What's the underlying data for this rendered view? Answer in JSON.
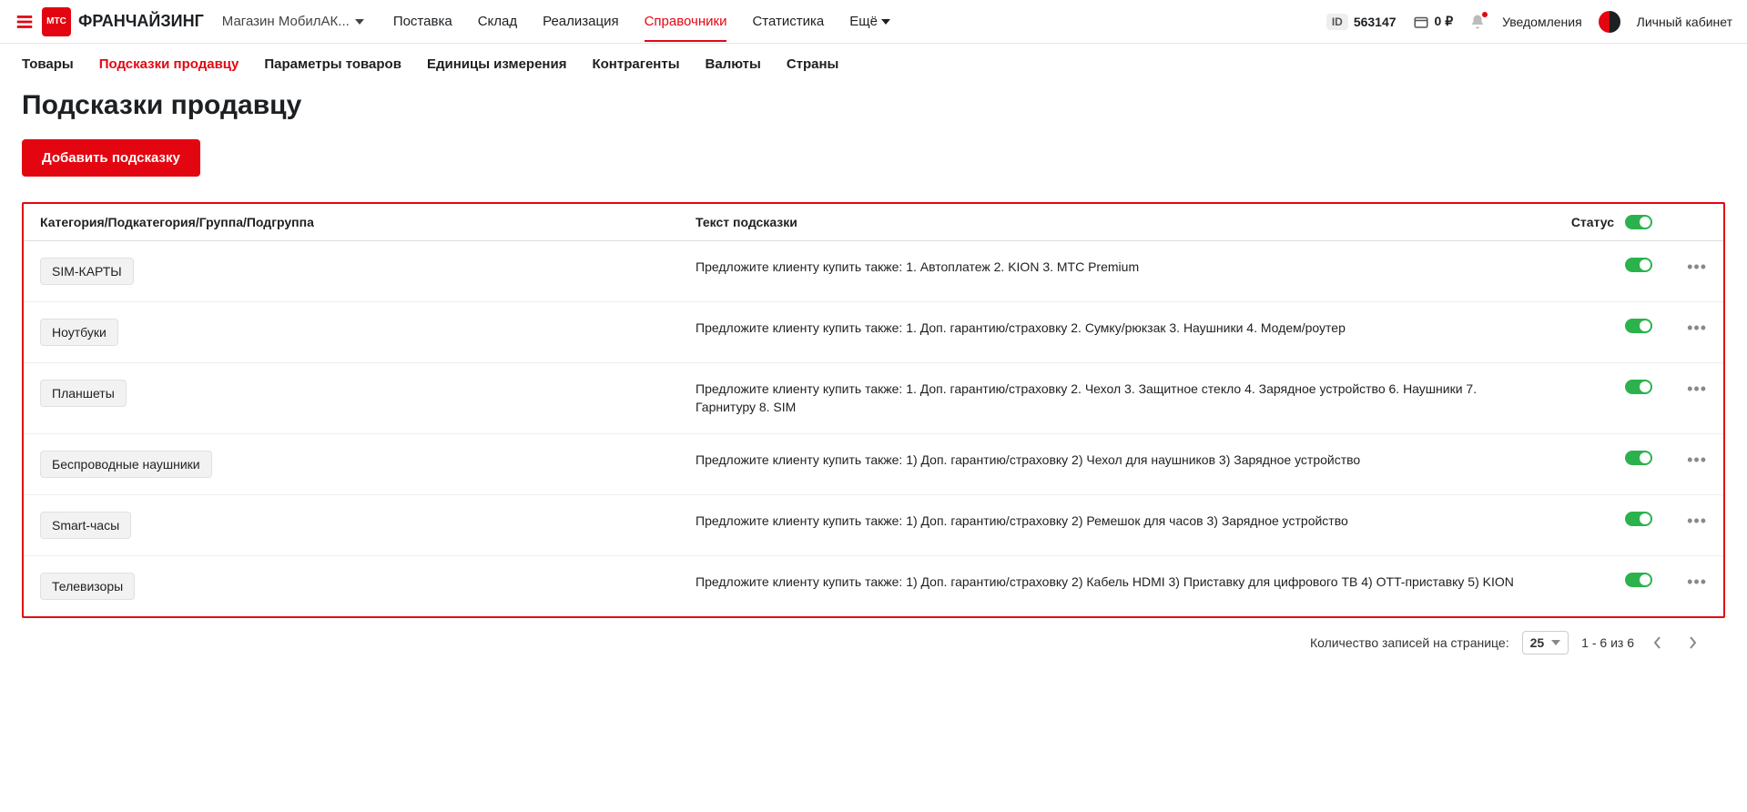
{
  "header": {
    "brand": "ФРАНЧАЙЗИНГ",
    "logo_text": "МТС",
    "store": "Магазин МобилАК...",
    "nav": [
      "Поставка",
      "Склад",
      "Реализация",
      "Справочники",
      "Статистика"
    ],
    "nav_active_index": 3,
    "more": "Ещё",
    "id_label": "ID",
    "id_value": "563147",
    "balance": "0 ₽",
    "notifications": "Уведомления",
    "cabinet": "Личный кабинет"
  },
  "subnav": {
    "items": [
      "Товары",
      "Подсказки продавцу",
      "Параметры товаров",
      "Единицы измерения",
      "Контрагенты",
      "Валюты",
      "Страны"
    ],
    "active_index": 1
  },
  "page": {
    "title": "Подсказки продавцу",
    "add_button": "Добавить подсказку"
  },
  "table": {
    "headers": {
      "category": "Категория/Подкатегория/Группа/Подгруппа",
      "text": "Текст подсказки",
      "status": "Статус"
    },
    "rows": [
      {
        "category": "SIM-КАРТЫ",
        "text": "Предложите клиенту купить также: 1. Автоплатеж 2. KION 3. МТС Premium",
        "status": true
      },
      {
        "category": "Ноутбуки",
        "text": "Предложите клиенту купить также: 1. Доп. гарантию/страховку 2. Сумку/рюкзак 3. Наушники 4. Модем/роутер",
        "status": true
      },
      {
        "category": "Планшеты",
        "text": "Предложите клиенту купить также: 1. Доп. гарантию/страховку 2. Чехол 3. Защитное стекло 4. Зарядное устройство 6. Наушники 7. Гарнитуру 8. SIM",
        "status": true
      },
      {
        "category": "Беспроводные наушники",
        "text": "Предложите клиенту купить также: 1) Доп. гарантию/страховку 2) Чехол для наушников 3) Зарядное устройство",
        "status": true
      },
      {
        "category": "Smart-часы",
        "text": "Предложите клиенту купить также: 1) Доп. гарантию/страховку 2) Ремешок для часов 3) Зарядное устройство",
        "status": true
      },
      {
        "category": "Телевизоры",
        "text": "Предложите клиенту купить также: 1) Доп. гарантию/страховку 2) Кабель HDMI 3) Приставку для цифрового ТВ 4) OTT-приставку 5) KION",
        "status": true
      }
    ]
  },
  "pagination": {
    "per_page_label": "Количество записей на странице:",
    "per_page_value": "25",
    "range": "1 - 6 из 6"
  }
}
